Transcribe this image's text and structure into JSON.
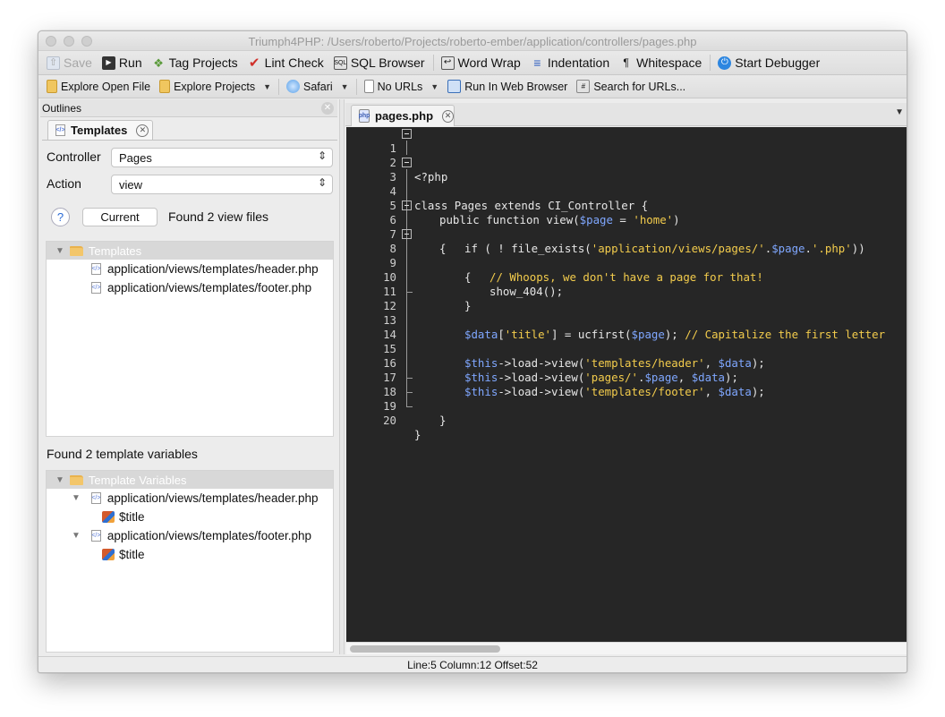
{
  "window": {
    "title": "Triumph4PHP: /Users/roberto/Projects/roberto-ember/application/controllers/pages.php"
  },
  "toolbar1": {
    "save": "Save",
    "run": "Run",
    "tag_projects": "Tag Projects",
    "lint_check": "Lint Check",
    "sql_browser": "SQL Browser",
    "word_wrap": "Word Wrap",
    "indentation": "Indentation",
    "whitespace": "Whitespace",
    "start_debugger": "Start Debugger"
  },
  "toolbar2": {
    "explore_open_file": "Explore Open File",
    "explore_projects": "Explore Projects",
    "safari": "Safari",
    "no_urls": "No URLs",
    "run_in_web_browser": "Run In Web Browser",
    "search_for_urls": "Search for URLs..."
  },
  "outlines": {
    "panel_title": "Outlines",
    "tab_label": "Templates",
    "controller_label": "Controller",
    "controller_value": "Pages",
    "action_label": "Action",
    "action_value": "view",
    "help_glyph": "?",
    "current_button": "Current",
    "found_views": "Found 2 view files",
    "templates_tree": {
      "root": "Templates",
      "files": [
        "application/views/templates/header.php",
        "application/views/templates/footer.php"
      ]
    },
    "found_vars": "Found 2 template variables",
    "vars_tree": {
      "root": "Template Variables",
      "file1": "application/views/templates/header.php",
      "file1_var": "$title",
      "file2": "application/views/templates/footer.php",
      "file2_var": "$title"
    }
  },
  "editor": {
    "tab_label": "pages.php",
    "line_numbers": [
      "1",
      "2",
      "3",
      "4",
      "5",
      "6",
      "7",
      "8",
      "9",
      "10",
      "11",
      "12",
      "13",
      "14",
      "15",
      "16",
      "17",
      "18",
      "19",
      "20"
    ],
    "tokens": {
      "l1": "<?php",
      "l3": "class Pages extends CI_Controller {",
      "l5a": "public function view(",
      "l5b": "$page",
      "l5c": " = ",
      "l5d": "'home'",
      "l5e": ")",
      "l6": "{",
      "l7a": "if ( ! file_exists(",
      "l7b": "'application/views/pages/'",
      "l7c": ".",
      "l7d": "$page",
      "l7e": ".",
      "l7f": "'.php'",
      "l7g": "))",
      "l8": "{",
      "l9": "// Whoops, we don't have a page for that!",
      "l10": "show_404();",
      "l11": "}",
      "l13a": "$data",
      "l13b": "[",
      "l13c": "'title'",
      "l13d": "] = ucfirst(",
      "l13e": "$page",
      "l13f": "); ",
      "l13g": "// Capitalize the first letter",
      "l15a": "$this",
      "l15b": "->load->view(",
      "l15c": "'templates/header'",
      "l15d": ", ",
      "l15e": "$data",
      "l15f": ");",
      "l16a": "$this",
      "l16b": "->load->view(",
      "l16c": "'pages/'",
      "l16d": ".",
      "l16e": "$page",
      "l16f": ", ",
      "l16g": "$data",
      "l16h": ");",
      "l17a": "$this",
      "l17b": "->load->view(",
      "l17c": "'templates/footer'",
      "l17d": ", ",
      "l17e": "$data",
      "l17f": ");",
      "l18": "}",
      "l19": "}"
    }
  },
  "status": {
    "text": "Line:5 Column:12 Offset:52"
  },
  "colors": {
    "editor_bg": "#262626",
    "variable": "#7fa7ff",
    "string": "#f3cc4c",
    "comment": "#f3cc4c",
    "default_text": "#e6e6e6"
  }
}
